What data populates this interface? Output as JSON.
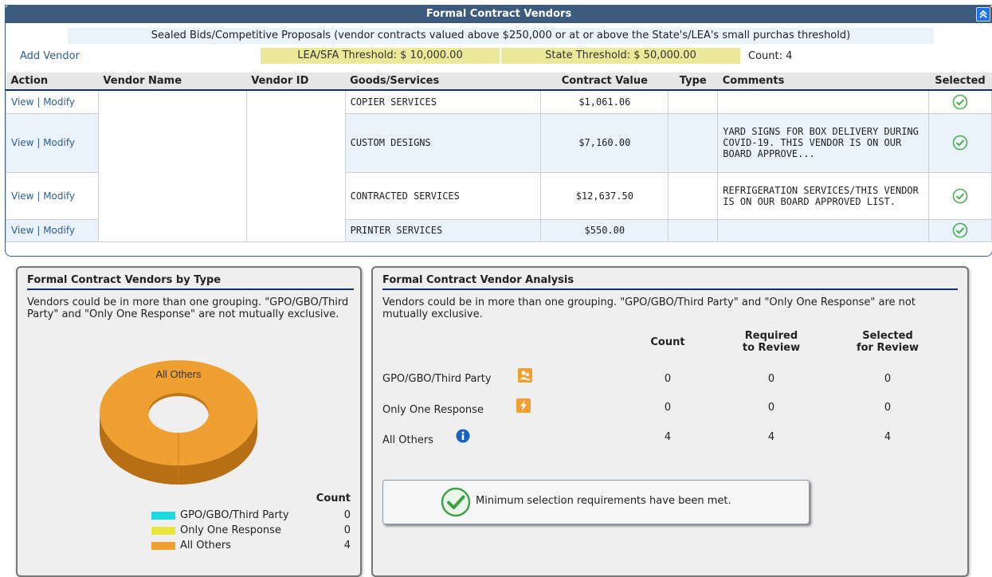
{
  "panel": {
    "title": "Formal Contract Vendors",
    "subtitle": "Sealed Bids/Competitive Proposals (vendor contracts valued above $250,000 or at or above the State's/LEA's small purchas threshold)",
    "add_vendor": "Add Vendor",
    "lea_threshold": "LEA/SFA Threshold: $ 10,000.00",
    "state_threshold": "State Threshold: $ 50,000.00",
    "count": "Count: 4"
  },
  "table": {
    "headers": [
      "Action",
      "Vendor Name",
      "Vendor ID",
      "Goods/Services",
      "Contract Value",
      "Type",
      "Comments",
      "Selected"
    ],
    "view_label": "View",
    "separator": "|",
    "modify_label": "Modify",
    "rows": [
      {
        "goods": "COPIER SERVICES",
        "value": "$1,061.06",
        "type": "",
        "comments": "",
        "selected": true
      },
      {
        "goods": "CUSTOM DESIGNS",
        "value": "$7,160.00",
        "type": "",
        "comments": "YARD SIGNS FOR BOX DELIVERY DURING COVID-19. THIS VENDOR IS ON OUR BOARD APPROVE...",
        "selected": true
      },
      {
        "goods": "CONTRACTED SERVICES",
        "value": "$12,637.50",
        "type": "",
        "comments": "REFRIGERATION SERVICES/THIS VENDOR IS ON OUR BOARD APPROVED LIST.",
        "selected": true
      },
      {
        "goods": "PRINTER SERVICES",
        "value": "$550.00",
        "type": "",
        "comments": "",
        "selected": true
      }
    ]
  },
  "by_type": {
    "title": "Formal Contract Vendors by Type",
    "note": "Vendors could be in more than one grouping. \"GPO/GBO/Third Party\" and \"Only One Response\" are not mutually exclusive.",
    "donut_label": "All Others",
    "legend_header": "Count",
    "legend": [
      {
        "name": "GPO/GBO/Third Party",
        "count": "0",
        "color": "#1fd8e0"
      },
      {
        "name": "Only One Response",
        "count": "0",
        "color": "#e8e63a"
      },
      {
        "name": "All Others",
        "count": "4",
        "color": "#f0a030"
      }
    ]
  },
  "analysis": {
    "title": "Formal Contract Vendor Analysis",
    "note": "Vendors could be in more than one grouping. \"GPO/GBO/Third Party\" and \"Only One Response\" are not mutually exclusive.",
    "col_count": "Count",
    "col_required_1": "Required",
    "col_required_2": "to Review",
    "col_selected_1": "Selected",
    "col_selected_2": "for Review",
    "rows": [
      {
        "label": "GPO/GBO/Third Party",
        "count": "0",
        "required": "0",
        "selected": "0",
        "icon": "group-icon"
      },
      {
        "label": "Only One Response",
        "count": "0",
        "required": "0",
        "selected": "0",
        "icon": "lightning-icon"
      },
      {
        "label": "All Others",
        "count": "4",
        "required": "4",
        "selected": "4",
        "icon": "info-icon"
      }
    ],
    "message": "Minimum selection requirements have been met."
  }
}
